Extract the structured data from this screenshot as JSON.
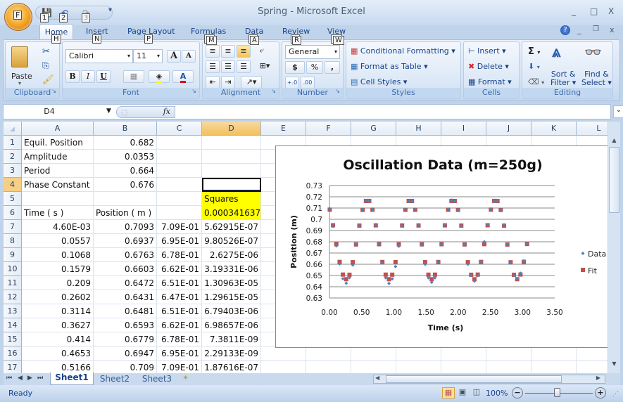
{
  "window": {
    "title": "Spring - Microsoft Excel",
    "minimize": "_",
    "maximize": "□",
    "close": "X"
  },
  "office_button": {
    "keytip": "F"
  },
  "qat": {
    "keytips": [
      "1",
      "2",
      "3"
    ]
  },
  "tabs": [
    {
      "label": "Home",
      "keytip": "H"
    },
    {
      "label": "Insert",
      "keytip": "N"
    },
    {
      "label": "Page Layout",
      "keytip": "P"
    },
    {
      "label": "Formulas",
      "keytip": "M"
    },
    {
      "label": "Data",
      "keytip": "A"
    },
    {
      "label": "Review",
      "keytip": "R"
    },
    {
      "label": "View",
      "keytip": "W"
    }
  ],
  "ribbon": {
    "clipboard": {
      "label": "Clipboard",
      "paste": "Paste"
    },
    "font": {
      "label": "Font",
      "name": "Calibri",
      "size": "11",
      "bold": "B",
      "italic": "I",
      "underline": "U",
      "grow": "A",
      "shrink": "A"
    },
    "alignment": {
      "label": "Alignment"
    },
    "number": {
      "label": "Number",
      "format": "General",
      "currency": "$",
      "percent": "%",
      "comma": ",",
      "inc_decimal": "+.0",
      "dec_decimal": ".00"
    },
    "styles": {
      "label": "Styles",
      "conditional": "Conditional Formatting",
      "format_table": "Format as Table",
      "cell_styles": "Cell Styles"
    },
    "cells": {
      "label": "Cells",
      "insert": "Insert",
      "delete": "Delete",
      "format": "Format"
    },
    "editing": {
      "label": "Editing",
      "sum": "Σ",
      "sort": "Sort &",
      "sort2": "Filter",
      "find": "Find &",
      "find2": "Select"
    }
  },
  "formula_bar": {
    "name_box": "D4",
    "fx": "fx",
    "value": ""
  },
  "columns": [
    "A",
    "B",
    "C",
    "D",
    "E",
    "F",
    "G",
    "H",
    "I",
    "J",
    "K",
    "L"
  ],
  "selected_cell": "D4",
  "rows": [
    {
      "n": "1",
      "A": "Equil. Position",
      "B": "0.682",
      "C": "",
      "D": ""
    },
    {
      "n": "2",
      "A": "Amplitude",
      "B": "0.0353",
      "C": "",
      "D": ""
    },
    {
      "n": "3",
      "A": "Period",
      "B": "0.664",
      "C": "",
      "D": ""
    },
    {
      "n": "4",
      "A": "Phase Constant",
      "B": "0.676",
      "C": "",
      "D": ""
    },
    {
      "n": "5",
      "A": "",
      "B": "",
      "C": "",
      "D": "Squares"
    },
    {
      "n": "6",
      "A": "Time ( s )",
      "B": "Position ( m )",
      "C": "",
      "D": "0.000341637"
    },
    {
      "n": "7",
      "A": "4.60E-03",
      "B": "0.7093",
      "C": "7.09E-01",
      "D": "5.62915E-07"
    },
    {
      "n": "8",
      "A": "0.0557",
      "B": "0.6937",
      "C": "6.95E-01",
      "D": "9.80526E-07"
    },
    {
      "n": "9",
      "A": "0.1068",
      "B": "0.6763",
      "C": "6.78E-01",
      "D": "2.6275E-06"
    },
    {
      "n": "10",
      "A": "0.1579",
      "B": "0.6603",
      "C": "6.62E-01",
      "D": "3.19331E-06"
    },
    {
      "n": "11",
      "A": "0.209",
      "B": "0.6472",
      "C": "6.51E-01",
      "D": "1.30963E-05"
    },
    {
      "n": "12",
      "A": "0.2602",
      "B": "0.6431",
      "C": "6.47E-01",
      "D": "1.29615E-05"
    },
    {
      "n": "13",
      "A": "0.3114",
      "B": "0.6481",
      "C": "6.51E-01",
      "D": "6.79403E-06"
    },
    {
      "n": "14",
      "A": "0.3627",
      "B": "0.6593",
      "C": "6.62E-01",
      "D": "6.98657E-06"
    },
    {
      "n": "15",
      "A": "0.414",
      "B": "0.6779",
      "C": "6.78E-01",
      "D": "7.3811E-09"
    },
    {
      "n": "16",
      "A": "0.4653",
      "B": "0.6947",
      "C": "6.95E-01",
      "D": "2.29133E-09"
    },
    {
      "n": "17",
      "A": "0.5166",
      "B": "0.709",
      "C": "7.09E-01",
      "D": "1.87616E-07"
    }
  ],
  "highlight_color": "#ffff00",
  "sheets": [
    "Sheet1",
    "Sheet2",
    "Sheet3"
  ],
  "active_sheet": "Sheet1",
  "status": {
    "ready": "Ready",
    "zoom": "100%"
  },
  "chart_data": {
    "type": "scatter",
    "title": "Oscillation Data (m=250g)",
    "xlabel": "Time (s)",
    "ylabel": "Position (m)",
    "xlim": [
      0,
      3.5
    ],
    "ylim": [
      0.63,
      0.73
    ],
    "xticks": [
      "0.00",
      "0.50",
      "1.00",
      "1.50",
      "2.00",
      "2.50",
      "3.00",
      "3.50"
    ],
    "yticks": [
      "0.73",
      "0.72",
      "0.71",
      "0.7",
      "0.69",
      "0.68",
      "0.67",
      "0.66",
      "0.65",
      "0.64",
      "0.63"
    ],
    "grid": true,
    "legend_position": "right",
    "fit_params": {
      "equilibrium": 0.682,
      "amplitude": 0.0353,
      "period": 0.664,
      "phase": 0.676
    },
    "series": [
      {
        "name": "Data",
        "color": "#4f81bd",
        "marker": "diamond",
        "t_start": 0.0046,
        "dt": 0.0511,
        "y": [
          0.7093,
          0.6937,
          0.6763,
          0.6603,
          0.6472,
          0.6431,
          0.6481,
          0.6593,
          0.6779,
          0.6947,
          0.709,
          0.7165,
          0.7165,
          0.709,
          0.6947,
          0.678,
          0.661,
          0.648,
          0.643,
          0.647,
          0.658,
          0.676,
          0.694,
          0.709,
          0.716,
          0.716,
          0.709,
          0.695,
          0.677,
          0.66,
          0.648,
          0.644,
          0.648,
          0.662,
          0.678,
          0.695,
          0.709,
          0.717,
          0.716,
          0.708,
          0.694,
          0.678,
          0.66,
          0.65,
          0.645,
          0.65,
          0.662,
          0.68,
          0.695,
          0.709,
          0.716,
          0.716,
          0.708,
          0.695,
          0.678,
          0.661,
          0.65,
          0.647,
          0.652,
          0.663,
          0.678
        ]
      },
      {
        "name": "Fit",
        "color": "#c0504d",
        "marker": "square",
        "t_start": 0.0046,
        "dt": 0.0511,
        "y": "computed from fit_params"
      }
    ]
  }
}
